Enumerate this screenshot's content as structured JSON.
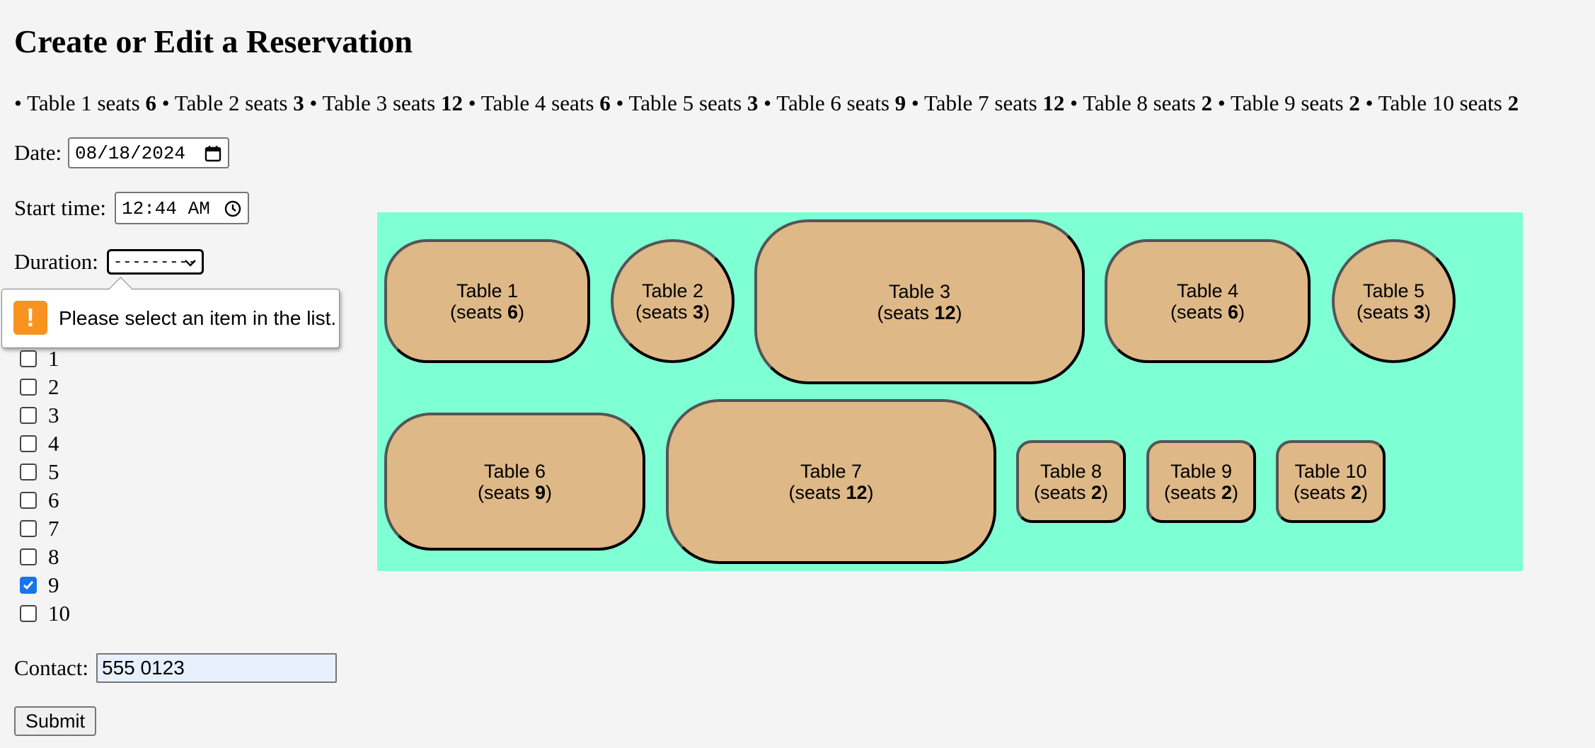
{
  "page": {
    "title": "Create or Edit a Reservation"
  },
  "summary": {
    "tables": [
      {
        "name": "Table 1",
        "seats": "6"
      },
      {
        "name": "Table 2",
        "seats": "3"
      },
      {
        "name": "Table 3",
        "seats": "12"
      },
      {
        "name": "Table 4",
        "seats": "6"
      },
      {
        "name": "Table 5",
        "seats": "3"
      },
      {
        "name": "Table 6",
        "seats": "9"
      },
      {
        "name": "Table 7",
        "seats": "12"
      },
      {
        "name": "Table 8",
        "seats": "2"
      },
      {
        "name": "Table 9",
        "seats": "2"
      },
      {
        "name": "Table 10",
        "seats": "2"
      }
    ],
    "bullet": "•",
    "seats_word": "seats"
  },
  "form": {
    "date": {
      "label": "Date:",
      "value": "08/18/2024",
      "icon": "calendar-icon"
    },
    "start_time": {
      "label": "Start time:",
      "value": "12:44 AM",
      "icon": "clock-icon"
    },
    "duration": {
      "label": "Duration:",
      "value": "---------",
      "icon": "chevron-down-icon"
    },
    "validation": {
      "message": "Please select an item in the list.",
      "icon": "warning-icon",
      "glyph": "!"
    },
    "table_checkboxes": [
      {
        "label": "1",
        "checked": false
      },
      {
        "label": "2",
        "checked": false
      },
      {
        "label": "3",
        "checked": false
      },
      {
        "label": "4",
        "checked": false
      },
      {
        "label": "5",
        "checked": false
      },
      {
        "label": "6",
        "checked": false
      },
      {
        "label": "7",
        "checked": false
      },
      {
        "label": "8",
        "checked": false
      },
      {
        "label": "9",
        "checked": true
      },
      {
        "label": "10",
        "checked": false
      }
    ],
    "contact": {
      "label": "Contact:",
      "value": "555 0123"
    },
    "submit_label": "Submit"
  },
  "floor_plan": {
    "background": "#7fffd4",
    "table_color": "#deb887",
    "seats_prefix": "(seats ",
    "seats_suffix": ")",
    "tables": [
      {
        "name": "Table 1",
        "seats": "6"
      },
      {
        "name": "Table 2",
        "seats": "3"
      },
      {
        "name": "Table 3",
        "seats": "12"
      },
      {
        "name": "Table 4",
        "seats": "6"
      },
      {
        "name": "Table 5",
        "seats": "3"
      },
      {
        "name": "Table 6",
        "seats": "9"
      },
      {
        "name": "Table 7",
        "seats": "12"
      },
      {
        "name": "Table 8",
        "seats": "2"
      },
      {
        "name": "Table 9",
        "seats": "2"
      },
      {
        "name": "Table 10",
        "seats": "2"
      }
    ]
  }
}
